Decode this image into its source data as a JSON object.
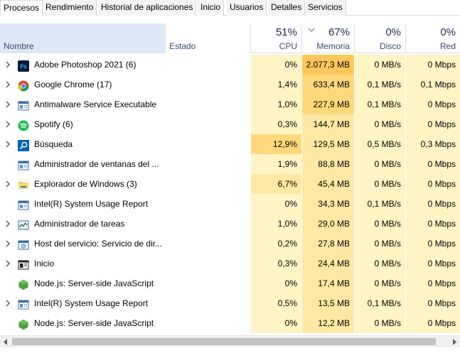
{
  "tabs": [
    "Procesos",
    "Rendimiento",
    "Historial de aplicaciones",
    "Inicio",
    "Usuarios",
    "Detalles",
    "Servicios"
  ],
  "columns": {
    "name": "Nombre",
    "status": "Estado",
    "cpu": {
      "percent": "51%",
      "label": "CPU"
    },
    "memory": {
      "percent": "67%",
      "label": "Memoria"
    },
    "disk": {
      "percent": "0%",
      "label": "Disco"
    },
    "network": {
      "percent": "0%",
      "label": "Red"
    }
  },
  "processes": [
    {
      "name": "Adobe Photoshop 2021 (6)",
      "icon": "photoshop-icon",
      "expandable": true,
      "cpu": "0%",
      "memory": "2.077,3 MB",
      "disk": "0 MB/s",
      "network": "0 Mbps"
    },
    {
      "name": "Google Chrome (17)",
      "icon": "chrome-icon",
      "expandable": true,
      "cpu": "1,4%",
      "memory": "633,4 MB",
      "disk": "0,1 MB/s",
      "network": "0,1 Mbps"
    },
    {
      "name": "Antimalware Service Executable",
      "icon": "service-window-icon",
      "expandable": true,
      "cpu": "1,0%",
      "memory": "227,9 MB",
      "disk": "0,1 MB/s",
      "network": "0 Mbps"
    },
    {
      "name": "Spotify (6)",
      "icon": "spotify-icon",
      "expandable": true,
      "cpu": "0,3%",
      "memory": "144,7 MB",
      "disk": "0 MB/s",
      "network": "0 Mbps"
    },
    {
      "name": "Búsqueda",
      "icon": "search-icon",
      "expandable": true,
      "cpu": "12,9%",
      "memory": "129,5 MB",
      "disk": "0,5 MB/s",
      "network": "0,3 Mbps"
    },
    {
      "name": "Administrador de ventanas del ...",
      "icon": "window-manager-icon",
      "expandable": false,
      "cpu": "1,9%",
      "memory": "88,8 MB",
      "disk": "0 MB/s",
      "network": "0 Mbps"
    },
    {
      "name": "Explorador de Windows (3)",
      "icon": "folder-icon",
      "expandable": true,
      "cpu": "6,7%",
      "memory": "45,4 MB",
      "disk": "0 MB/s",
      "network": "0 Mbps"
    },
    {
      "name": "Intel(R) System Usage Report",
      "icon": "service-window-icon",
      "expandable": false,
      "cpu": "0%",
      "memory": "34,3 MB",
      "disk": "0,1 MB/s",
      "network": "0 Mbps"
    },
    {
      "name": "Administrador de tareas",
      "icon": "task-manager-icon",
      "expandable": true,
      "cpu": "1,0%",
      "memory": "29,0 MB",
      "disk": "0 MB/s",
      "network": "0 Mbps"
    },
    {
      "name": "Host del servicio: Servicio de dir...",
      "icon": "service-host-icon",
      "expandable": true,
      "cpu": "0,2%",
      "memory": "27,8 MB",
      "disk": "0 MB/s",
      "network": "0 Mbps"
    },
    {
      "name": "Inicio",
      "icon": "start-icon",
      "expandable": true,
      "cpu": "0,3%",
      "memory": "24,4 MB",
      "disk": "0 MB/s",
      "network": "0 Mbps"
    },
    {
      "name": "Node.js: Server-side JavaScript",
      "icon": "nodejs-icon",
      "expandable": false,
      "cpu": "0%",
      "memory": "17,4 MB",
      "disk": "0 MB/s",
      "network": "0 Mbps"
    },
    {
      "name": "Intel(R) System Usage Report",
      "icon": "service-window-icon",
      "expandable": true,
      "cpu": "0,5%",
      "memory": "13,5 MB",
      "disk": "0,1 MB/s",
      "network": "0 Mbps"
    },
    {
      "name": "Node.js: Server-side JavaScript",
      "icon": "nodejs-icon",
      "expandable": false,
      "cpu": "0%",
      "memory": "12,2 MB",
      "disk": "0 MB/s",
      "network": "0 Mbps"
    }
  ],
  "colors": {
    "heat_low": "#fff4c4",
    "heat_mid": "#ffe8a3",
    "heat_high": "#ffd87a",
    "heat_max": "#ffc759",
    "name_header_highlight": "#dbe9f7"
  }
}
